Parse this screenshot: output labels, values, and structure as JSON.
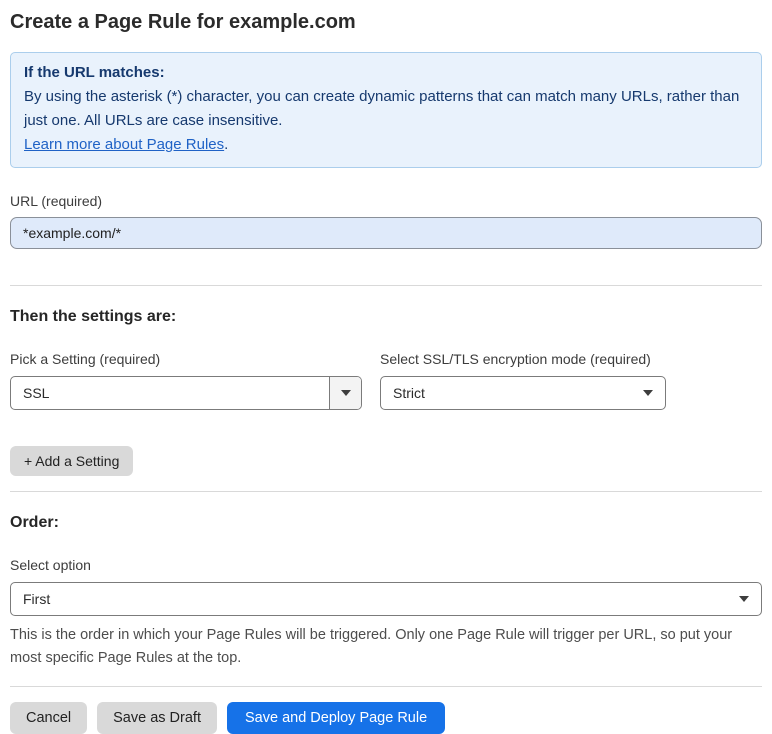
{
  "page": {
    "title": "Create a Page Rule for example.com"
  },
  "info_box": {
    "heading": "If the URL matches:",
    "body": "By using the asterisk (*) character, you can create dynamic patterns that can match many URLs, rather than just one. All URLs are case insensitive.",
    "link_label": "Learn more about Page Rules",
    "link_suffix": "."
  },
  "url_field": {
    "label": "URL (required)",
    "value": "*example.com/*"
  },
  "settings_section": {
    "heading": "Then the settings are:",
    "setting_picker": {
      "label": "Pick a Setting (required)",
      "value": "SSL"
    },
    "ssl_mode_picker": {
      "label": "Select SSL/TLS encryption mode (required)",
      "value": "Strict"
    },
    "add_setting_label": "+ Add a Setting"
  },
  "order_section": {
    "heading": "Order:",
    "select_label": "Select option",
    "value": "First",
    "help_text": "This is the order in which your Page Rules will be triggered. Only one Page Rule will trigger per URL, so put your most specific Page Rules at the top."
  },
  "actions": {
    "cancel": "Cancel",
    "save_draft": "Save as Draft",
    "save_deploy": "Save and Deploy Page Rule"
  },
  "colors": {
    "info_bg": "#e9f2fc",
    "info_border": "#abceec",
    "info_text": "#16396e",
    "link": "#1f62c6",
    "url_input_bg": "#dfeafa",
    "primary_button": "#1672e8",
    "grey_button": "#d9d9d9"
  }
}
